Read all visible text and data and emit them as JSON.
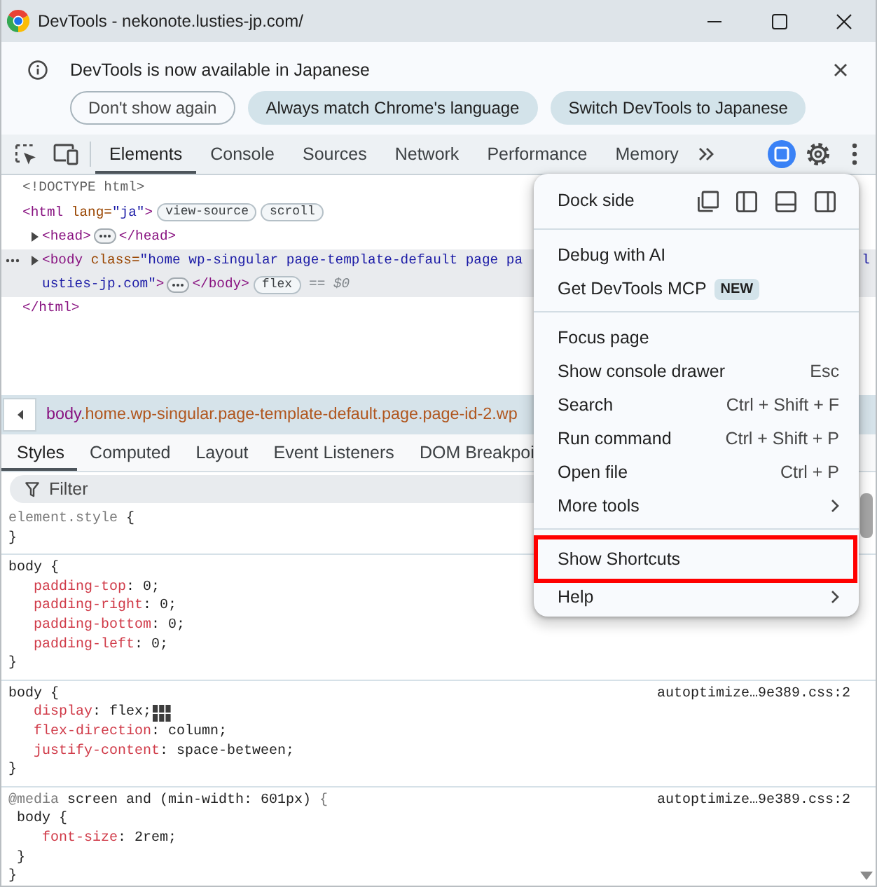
{
  "window": {
    "title": "DevTools - nekonote.lusties-jp.com/"
  },
  "infobar": {
    "message": "DevTools is now available in Japanese",
    "buttons": [
      {
        "label": "Don't show again",
        "kind": "outline"
      },
      {
        "label": "Always match Chrome's language",
        "kind": "filled"
      },
      {
        "label": "Switch DevTools to Japanese",
        "kind": "filled"
      }
    ]
  },
  "main_tabs": [
    {
      "label": "Elements",
      "selected": true
    },
    {
      "label": "Console",
      "selected": false
    },
    {
      "label": "Sources",
      "selected": false
    },
    {
      "label": "Network",
      "selected": false
    },
    {
      "label": "Performance",
      "selected": false
    },
    {
      "label": "Memory",
      "selected": false
    }
  ],
  "dom_tree": [
    {
      "lines": [
        {
          "tokens": [
            {
              "kind": "doctype",
              "text": "<!DOCTYPE html>"
            }
          ]
        }
      ]
    },
    {
      "lines": [
        {
          "tokens": [
            {
              "kind": "tag",
              "text": "<html"
            },
            {
              "kind": "attr",
              "text": " lang="
            },
            {
              "kind": "value",
              "text": "\"ja\""
            },
            {
              "kind": "tag",
              "text": ">"
            },
            {
              "kind": "badge",
              "text": "view-source"
            },
            {
              "kind": "badge",
              "text": "scroll"
            }
          ]
        }
      ],
      "children": [
        {
          "expanded": false,
          "selected": false,
          "lines": [
            {
              "tokens": [
                {
                  "kind": "tag",
                  "text": "<head>"
                },
                {
                  "kind": "ellipsis"
                },
                {
                  "kind": "tag",
                  "text": "</head>"
                }
              ]
            }
          ]
        },
        {
          "expanded": false,
          "selected": true,
          "lines": [
            {
              "tokens": [
                {
                  "kind": "tag",
                  "text": "<body"
                },
                {
                  "kind": "attr",
                  "text": " class="
                },
                {
                  "kind": "value",
                  "text": "\"home wp-singular page-template-default page pa"
                }
              ]
            },
            {
              "tokens": [
                {
                  "kind": "value",
                  "text": "usties-jp.com\""
                },
                {
                  "kind": "tag",
                  "text": ">"
                },
                {
                  "kind": "ellipsis"
                },
                {
                  "kind": "tag",
                  "text": "</body>"
                },
                {
                  "kind": "badge",
                  "text": "flex"
                },
                {
                  "kind": "hint",
                  "text": "== $0"
                }
              ]
            }
          ],
          "right_fragment": "l"
        }
      ],
      "closing": {
        "tokens": [
          {
            "kind": "tag",
            "text": "</html>"
          }
        ]
      }
    }
  ],
  "breadcrumb": [
    {
      "kind": "tag",
      "text": "body"
    },
    {
      "kind": "cls",
      "text": ".home.wp-singular.page-template-default.page.page-id-2.wp"
    }
  ],
  "sidebar_tabs": [
    {
      "label": "Styles",
      "selected": true
    },
    {
      "label": "Computed",
      "selected": false
    },
    {
      "label": "Layout",
      "selected": false
    },
    {
      "label": "Event Listeners",
      "selected": false
    },
    {
      "label": "DOM Breakpoi",
      "selected": false
    }
  ],
  "filter": {
    "placeholder": "Filter"
  },
  "style_rules": [
    {
      "kind": "inline",
      "selector": "element.style",
      "open": " {",
      "close": "}"
    },
    {
      "kind": "rule",
      "selector": "body",
      "open": " {",
      "close": "}",
      "declarations": [
        {
          "kind": "plain",
          "property": "padding-top",
          "rest": ": 0;"
        },
        {
          "kind": "plain",
          "property": "padding-right",
          "rest": ": 0;"
        },
        {
          "kind": "plain",
          "property": "padding-bottom",
          "rest": ": 0;"
        },
        {
          "kind": "plain",
          "property": "padding-left",
          "rest": ": 0;"
        }
      ]
    },
    {
      "kind": "rule",
      "selector": "body",
      "open": " {",
      "close": "}",
      "source": "autoptimize…9e389.css:2",
      "declarations": [
        {
          "kind": "flexbox",
          "property": "display",
          "rest": ": flex;"
        },
        {
          "kind": "plain",
          "property": "flex-direction",
          "rest": ": column;"
        },
        {
          "kind": "plain",
          "property": "justify-content",
          "rest": ": space-between;"
        }
      ]
    },
    {
      "kind": "media",
      "at_keyword": "@media",
      "condition": " screen and (min-width: 601px)",
      "open": " {",
      "close": "}",
      "source": "autoptimize…9e389.css:2",
      "rules": [
        {
          "selector": "body",
          "open": " {",
          "close": "}",
          "declarations": [
            {
              "property": "font-size",
              "rest": ": 2rem;"
            }
          ]
        }
      ]
    }
  ],
  "menu": {
    "dock": {
      "label": "Dock side",
      "options": [
        {
          "kind": "undock"
        },
        {
          "kind": "left"
        },
        {
          "kind": "bottom"
        },
        {
          "kind": "right"
        }
      ]
    },
    "sections": [
      {
        "items": [
          {
            "label": "Debug with AI",
            "submenu": false,
            "marked": false
          },
          {
            "label": "Get DevTools MCP",
            "badge": "NEW",
            "submenu": false,
            "marked": false
          }
        ]
      },
      {
        "items": [
          {
            "label": "Focus page",
            "submenu": false,
            "marked": false
          },
          {
            "label": "Show console drawer",
            "shortcut": "Esc",
            "submenu": false,
            "marked": false
          },
          {
            "label": "Search",
            "shortcut": "Ctrl + Shift + F",
            "submenu": false,
            "marked": false
          },
          {
            "label": "Run command",
            "shortcut": "Ctrl + Shift + P",
            "submenu": false,
            "marked": false
          },
          {
            "label": "Open file",
            "shortcut": "Ctrl + P",
            "submenu": false,
            "marked": false
          },
          {
            "label": "More tools",
            "submenu": true,
            "marked": false
          }
        ]
      },
      {
        "items": [
          {
            "label": "Show Shortcuts",
            "submenu": false,
            "marked": true
          },
          {
            "label": "Help",
            "submenu": true,
            "marked": false
          }
        ]
      }
    ]
  }
}
